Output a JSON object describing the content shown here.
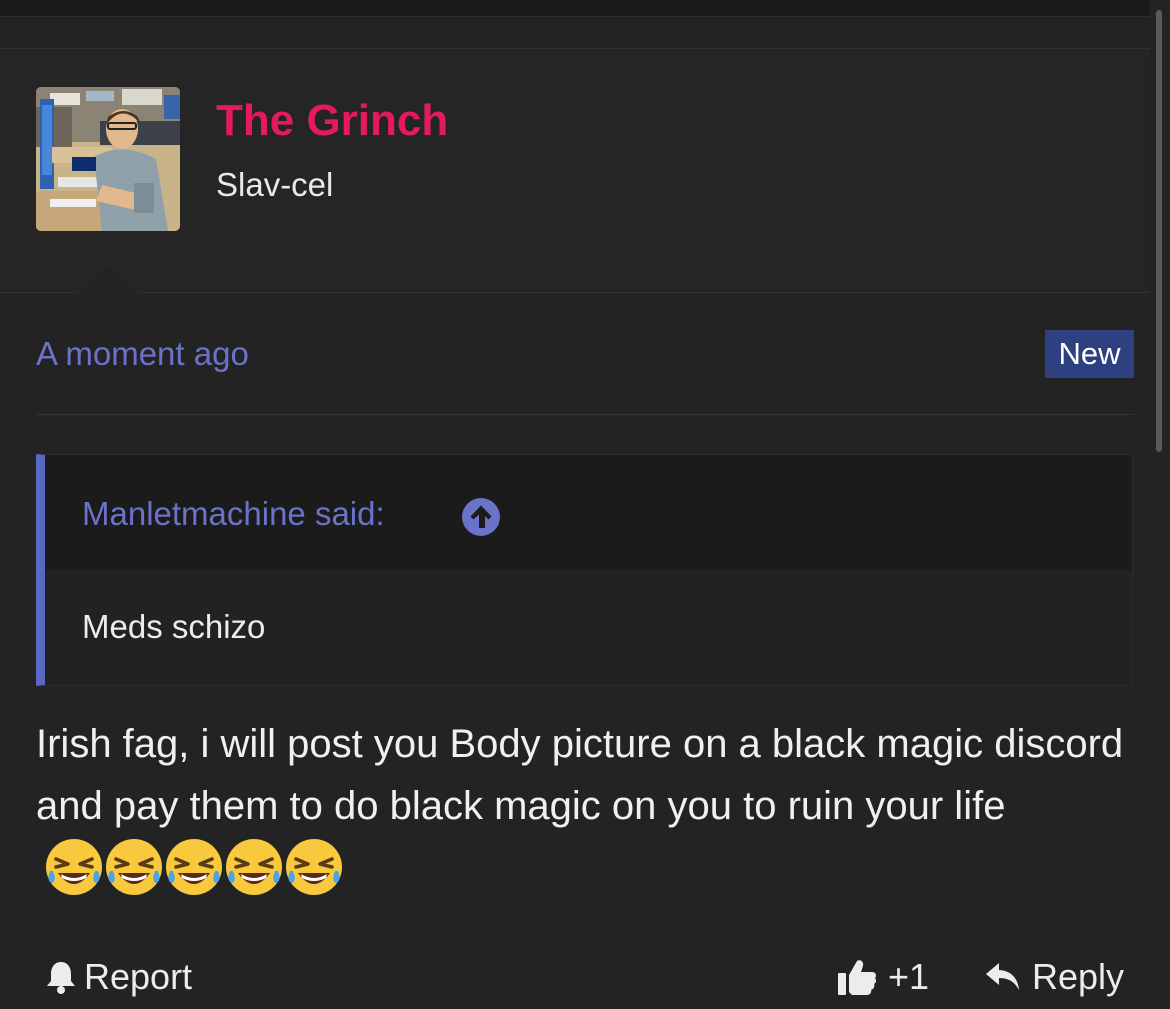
{
  "post": {
    "username": "The Grinch",
    "user_title": "Slav-cel",
    "timestamp": "A moment ago",
    "badge": "New"
  },
  "quote": {
    "author": "Manletmachine said:",
    "text": "Meds schizo"
  },
  "message": {
    "text": "Irish fag, i will post you Body picture on a black magic discord and pay them to do black magic on you to ruin your life",
    "emojis": [
      "laughing-tears-emoji",
      "laughing-tears-emoji",
      "laughing-tears-emoji",
      "laughing-tears-emoji",
      "laughing-tears-emoji"
    ]
  },
  "actions": {
    "report": "Report",
    "like_count": "+1",
    "reply": "Reply"
  },
  "colors": {
    "username": "#e6195f",
    "link": "#6a72c9",
    "badge_bg": "#2d4180",
    "quote_border": "#5968c2",
    "background": "#232323"
  },
  "icons": {
    "report": "bell-icon",
    "like": "thumbs-up-icon",
    "reply": "reply-arrow-icon",
    "quote_jump": "arrow-up-circle-icon"
  }
}
